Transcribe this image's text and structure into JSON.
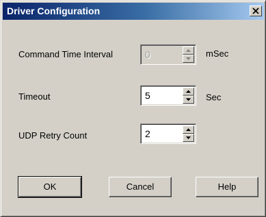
{
  "window": {
    "title": "Driver Configuration",
    "close_icon": "close-icon"
  },
  "fields": {
    "command_time_interval": {
      "label": "Command Time Interval",
      "value": "0",
      "unit": "mSec",
      "enabled": false
    },
    "timeout": {
      "label": "Timeout",
      "value": "5",
      "unit": "Sec",
      "enabled": true
    },
    "udp_retry_count": {
      "label": "UDP Retry Count",
      "value": "2",
      "enabled": true
    }
  },
  "buttons": {
    "ok": "OK",
    "cancel": "Cancel",
    "help": "Help"
  },
  "colors": {
    "title_start": "#0a246a",
    "title_end": "#a6caf0",
    "face": "#d4d0c8"
  }
}
